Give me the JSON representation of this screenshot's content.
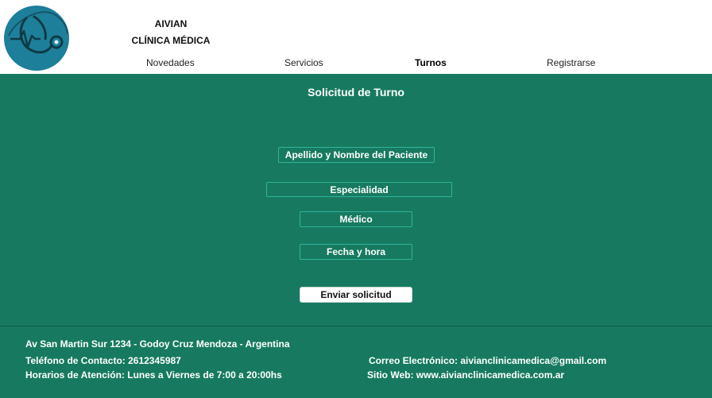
{
  "brand": {
    "line1": "AIVIAN",
    "line2": "CLÍNICA MÉDICA",
    "logo_icon": "stethoscope-icon"
  },
  "nav": {
    "items": [
      {
        "label": "Novedades"
      },
      {
        "label": "Servicios"
      },
      {
        "label": "Turnos",
        "active": true
      },
      {
        "label": "Registrarse"
      }
    ]
  },
  "form": {
    "title": "Solicitud de Turno",
    "patient_placeholder": "Apellido y Nombre del Paciente",
    "specialty_placeholder": "Especialidad",
    "doctor_placeholder": "Médico",
    "datetime_placeholder": "Fecha y hora",
    "submit_label": "Enviar solicitud"
  },
  "footer": {
    "address": "Av  San Martin Sur 1234 - Godoy Cruz  Mendoza - Argentina",
    "phone": "Teléfono de Contacto: 2612345987",
    "hours": "Horarios de Atención:  Lunes a Viernes de 7:00 a 20:00hs",
    "email": "Correo Electrónico: aivianclinicamedica@gmail.com",
    "website": "Sitio Web: www.aivianclinicamedica.com.ar"
  },
  "colors": {
    "primary_green": "#177a60",
    "logo_teal": "#1e7f9a",
    "field_border": "#2fb39a"
  }
}
